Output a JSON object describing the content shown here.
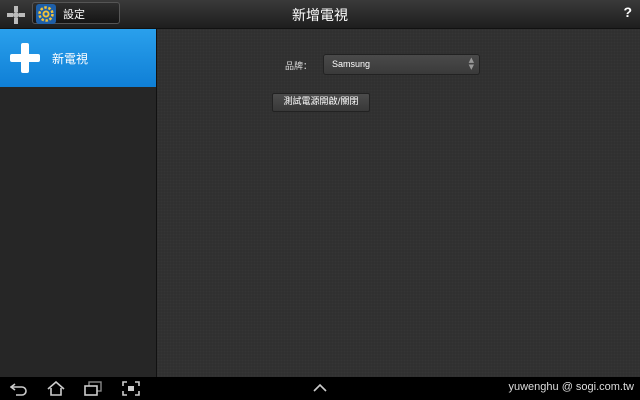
{
  "topbar": {
    "settings_label": "設定",
    "title": "新增電視",
    "help_label": "?"
  },
  "sidebar": {
    "items": [
      {
        "label": "新電視",
        "icon": "plus-icon",
        "selected": true
      }
    ]
  },
  "form": {
    "brand_label": "品牌：",
    "brand_value": "Samsung",
    "test_button_label": "測試電源開啟/關閉"
  },
  "navbar": {
    "icons": [
      "back-icon",
      "home-icon",
      "recent-apps-icon",
      "screenshot-icon",
      "up-chevron-icon"
    ],
    "watermark": "yuwenghu  @ sogi.com.tw"
  },
  "colors": {
    "accent": "#1a8fe3",
    "background": "#2b2b2b"
  }
}
